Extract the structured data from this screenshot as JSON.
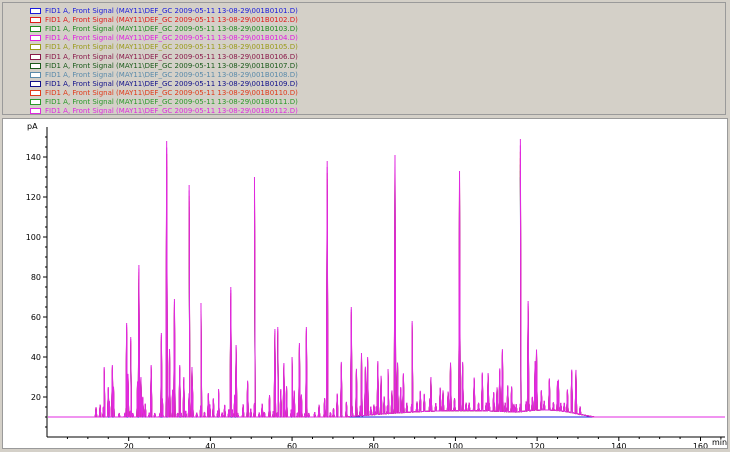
{
  "legend": [
    {
      "label": "FID1 A, Front Signal (MAY11\\DEF_GC 2009-05-11 13-08-29\\001B0101.D)",
      "color": "#1a1adc"
    },
    {
      "label": "FID1 A, Front Signal (MAY11\\DEF_GC 2009-05-11 13-08-29\\001B0102.D)",
      "color": "#e01b1b"
    },
    {
      "label": "FID1 A, Front Signal (MAY11\\DEF_GC 2009-05-11 13-08-29\\001B0103.D)",
      "color": "#1f8a1f"
    },
    {
      "label": "FID1 A, Front Signal (MAY11\\DEF_GC 2009-05-11 13-08-29\\001B0104.D)",
      "color": "#e01ee0"
    },
    {
      "label": "FID1 A, Front Signal (MAY11\\DEF_GC 2009-05-11 13-08-29\\001B0105.D)",
      "color": "#9a9a1a"
    },
    {
      "label": "FID1 A, Front Signal (MAY11\\DEF_GC 2009-05-11 13-08-29\\001B0106.D)",
      "color": "#8a1a4a"
    },
    {
      "label": "FID1 A, Front Signal (MAY11\\DEF_GC 2009-05-11 13-08-29\\001B0107.D)",
      "color": "#1a5a1a"
    },
    {
      "label": "FID1 A, Front Signal (MAY11\\DEF_GC 2009-05-11 13-08-29\\001B0108.D)",
      "color": "#5a8aaa"
    },
    {
      "label": "FID1 A, Front Signal (MAY11\\DEF_GC 2009-05-11 13-08-29\\001B0109.D)",
      "color": "#10108a"
    },
    {
      "label": "FID1 A, Front Signal (MAY11\\DEF_GC 2009-05-11 13-08-29\\001B0110.D)",
      "color": "#e03a1a"
    },
    {
      "label": "FID1 A, Front Signal (MAY11\\DEF_GC 2009-05-11 13-08-29\\001B0111.D)",
      "color": "#2a9a2a"
    },
    {
      "label": "FID1 A, Front Signal (MAY11\\DEF_GC 2009-05-11 13-08-29\\001B0112.D)",
      "color": "#e02ae0"
    }
  ],
  "chart_data": {
    "type": "line",
    "ylabel": "pA",
    "xlabel": "min",
    "xlim": [
      0,
      166
    ],
    "ylim": [
      0,
      155
    ],
    "xticks": [
      20,
      40,
      60,
      80,
      100,
      120,
      140,
      160
    ],
    "yticks": [
      20,
      40,
      60,
      80,
      100,
      120,
      140
    ],
    "grid": false,
    "baseline": 10,
    "peaks": [
      {
        "x": 12.0,
        "y": 15
      },
      {
        "x": 14.0,
        "y": 35
      },
      {
        "x": 15.0,
        "y": 25
      },
      {
        "x": 16.0,
        "y": 36
      },
      {
        "x": 19.5,
        "y": 57
      },
      {
        "x": 20.5,
        "y": 50
      },
      {
        "x": 22.5,
        "y": 86
      },
      {
        "x": 23.0,
        "y": 30
      },
      {
        "x": 25.5,
        "y": 36
      },
      {
        "x": 28.0,
        "y": 52
      },
      {
        "x": 29.3,
        "y": 148
      },
      {
        "x": 30.0,
        "y": 44
      },
      {
        "x": 31.2,
        "y": 69
      },
      {
        "x": 32.5,
        "y": 36
      },
      {
        "x": 33.5,
        "y": 30
      },
      {
        "x": 34.8,
        "y": 126
      },
      {
        "x": 35.5,
        "y": 35
      },
      {
        "x": 37.7,
        "y": 67
      },
      {
        "x": 39.5,
        "y": 22
      },
      {
        "x": 42.0,
        "y": 24
      },
      {
        "x": 45.0,
        "y": 75
      },
      {
        "x": 46.3,
        "y": 46
      },
      {
        "x": 50.8,
        "y": 130
      },
      {
        "x": 55.8,
        "y": 54
      },
      {
        "x": 56.5,
        "y": 55
      },
      {
        "x": 58.0,
        "y": 37
      },
      {
        "x": 60.0,
        "y": 40
      },
      {
        "x": 61.8,
        "y": 47
      },
      {
        "x": 63.5,
        "y": 55
      },
      {
        "x": 68.6,
        "y": 138
      },
      {
        "x": 74.5,
        "y": 65
      },
      {
        "x": 77.0,
        "y": 42
      },
      {
        "x": 78.5,
        "y": 40
      },
      {
        "x": 81.0,
        "y": 38
      },
      {
        "x": 83.5,
        "y": 34
      },
      {
        "x": 85.2,
        "y": 141
      },
      {
        "x": 89.4,
        "y": 58
      },
      {
        "x": 94.0,
        "y": 30
      },
      {
        "x": 101.0,
        "y": 133
      },
      {
        "x": 108.0,
        "y": 32
      },
      {
        "x": 115.9,
        "y": 149
      },
      {
        "x": 117.8,
        "y": 68
      },
      {
        "x": 119.5,
        "y": 38
      },
      {
        "x": 125.0,
        "y": 28
      }
    ]
  }
}
